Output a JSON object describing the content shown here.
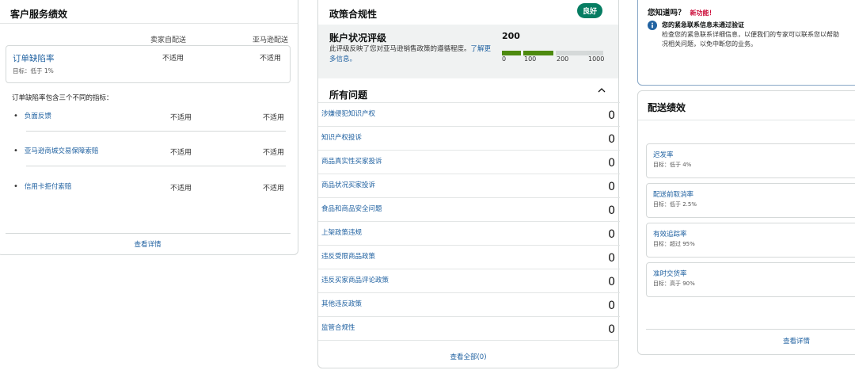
{
  "customer_service": {
    "title": "客户服务绩效",
    "col_mfn": "卖家自配送",
    "col_afn": "亚马逊配送",
    "odr": {
      "label": "订单缺陷率",
      "target": "目标：低于 1%",
      "mfn": "不适用",
      "afn": "不适用"
    },
    "intro": "订单缺陷率包含三个不同的指标：",
    "metrics": [
      {
        "label": "负面反馈",
        "mfn": "不适用",
        "afn": "不适用"
      },
      {
        "label": "亚马逊商城交易保障索赔",
        "mfn": "不适用",
        "afn": "不适用"
      },
      {
        "label": "信用卡拒付索赔",
        "mfn": "不适用",
        "afn": "不适用"
      }
    ],
    "footer_link": "查看详情"
  },
  "policy": {
    "title": "政策合规性",
    "status_badge": "良好",
    "status_color": "#067d62",
    "rating": {
      "title": "账户状况评级",
      "description": "此评级反映了您对亚马逊销售政策的遵循程度。",
      "learn_more": "了解更多信息。",
      "score": "200",
      "score_value": 200,
      "scale_ticks": [
        "0",
        "100",
        "200",
        "1000"
      ]
    },
    "issues_title": "所有问题",
    "issues": [
      {
        "label": "涉嫌侵犯知识产权",
        "count": "0"
      },
      {
        "label": "知识产权投诉",
        "count": "0"
      },
      {
        "label": "商品真实性买家投诉",
        "count": "0"
      },
      {
        "label": "商品状况买家投诉",
        "count": "0"
      },
      {
        "label": "食品和商品安全问题",
        "count": "0"
      },
      {
        "label": "上架政策违规",
        "count": "0"
      },
      {
        "label": "违反受限商品政策",
        "count": "0"
      },
      {
        "label": "违反买家商品评论政策",
        "count": "0"
      },
      {
        "label": "其他违反政策",
        "count": "0"
      },
      {
        "label": "监管合规性",
        "count": "0"
      }
    ],
    "footer_link": "查看全部(0)"
  },
  "did_you_know": {
    "question": "您知道吗？",
    "new_tag": "新功能！",
    "headline": "您的紧急联系信息未通过验证",
    "body_line1": "检查您的紧急联系详细信息，以便我们的专家可以联系您以帮助",
    "body_line2": "况相关问题，以免中断您的业务。"
  },
  "shipping": {
    "title": "配送绩效",
    "metrics": [
      {
        "label": "迟发率",
        "target": "目标：低于 4%"
      },
      {
        "label": "配送前取消率",
        "target": "目标：低于 2.5%"
      },
      {
        "label": "有效追踪率",
        "target": "目标：超过 95%"
      },
      {
        "label": "准时交货率",
        "target": "目标：高于 90%"
      }
    ],
    "footer_link": "查看详情"
  },
  "colors": {
    "link": "#2162a1",
    "good_green": "#067d62",
    "bar_green": "#4d8a0f",
    "bar_grey": "#d5d9d9"
  }
}
